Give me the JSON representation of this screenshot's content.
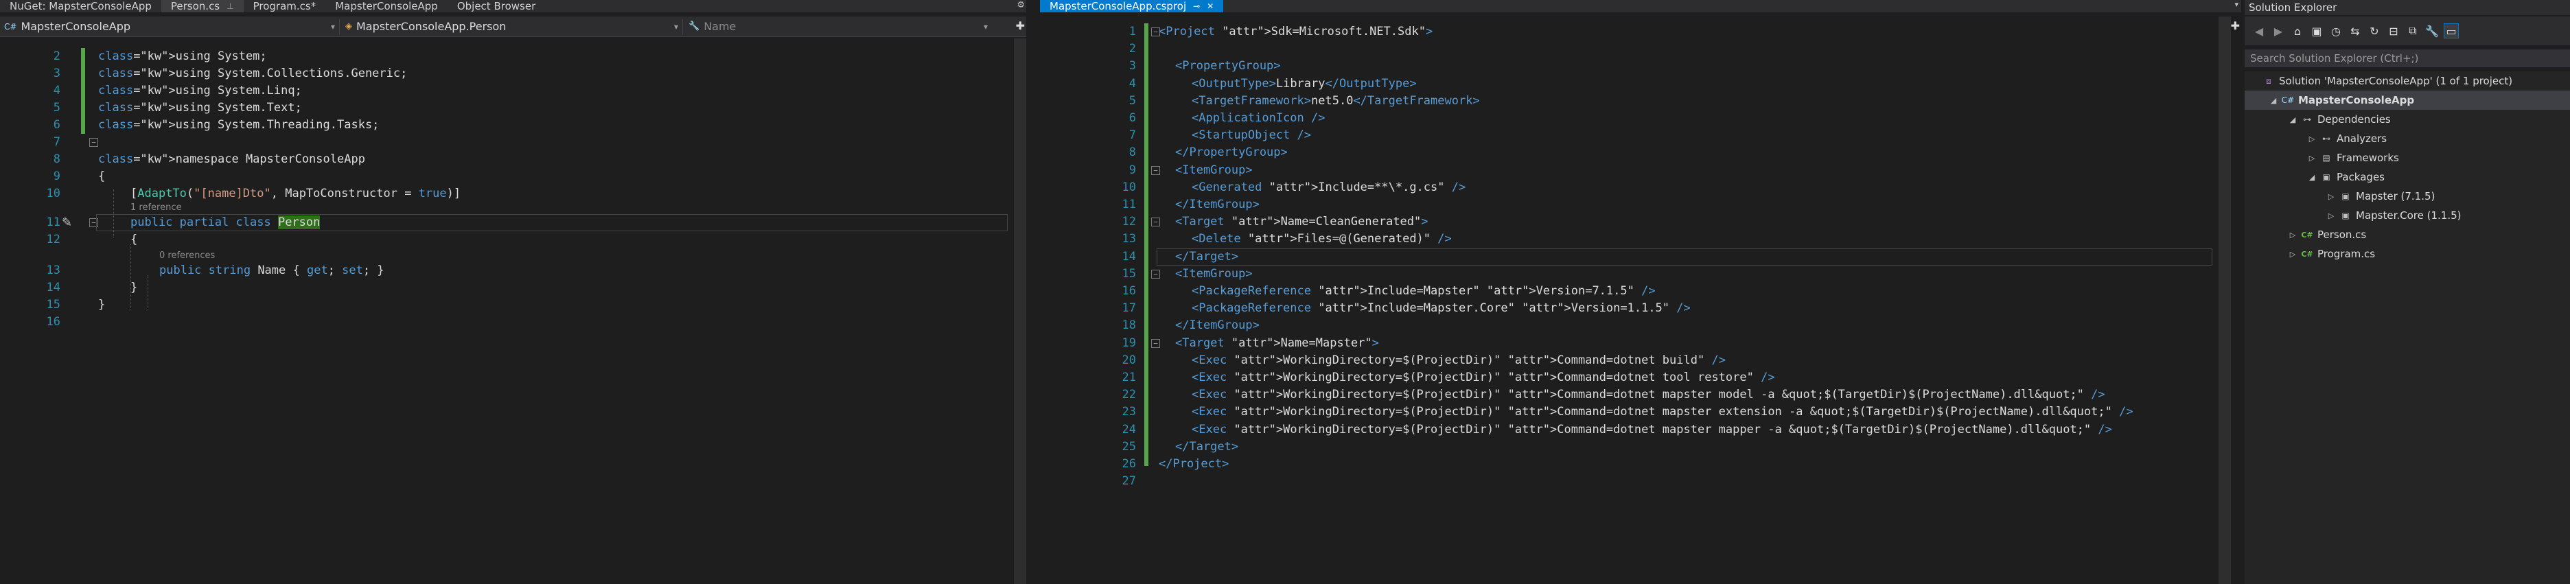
{
  "left_tabs": [
    {
      "label": "NuGet: MapsterConsoleApp",
      "active": false
    },
    {
      "label": "Person.cs",
      "active": false,
      "mark": "⊥"
    },
    {
      "label": "Program.cs*",
      "active": false
    },
    {
      "label": "MapsterConsoleApp",
      "active": false
    },
    {
      "label": "Object Browser",
      "active": false
    }
  ],
  "right_tab": {
    "label": "MapsterConsoleApp.csproj",
    "mark": "⊸",
    "close": "✕"
  },
  "nav": {
    "project": "MapsterConsoleApp",
    "type": "MapsterConsoleApp.Person",
    "member": "Name"
  },
  "cs_editor": {
    "lines": [
      {
        "n": "2",
        "text": "using System;"
      },
      {
        "n": "3",
        "text": "using System.Collections.Generic;"
      },
      {
        "n": "4",
        "text": "using System.Linq;"
      },
      {
        "n": "5",
        "text": "using System.Text;"
      },
      {
        "n": "6",
        "text": "using System.Threading.Tasks;"
      },
      {
        "n": "7",
        "text": ""
      },
      {
        "n": "8",
        "text": "namespace MapsterConsoleApp"
      },
      {
        "n": "9",
        "text": "{"
      },
      {
        "n": "10",
        "text": "[AdaptTo(\"[name]Dto\", MapToConstructor = true)]"
      },
      {
        "n": "11",
        "text": "public partial class Person"
      },
      {
        "n": "12",
        "text": "{"
      },
      {
        "n": "13",
        "text": "public string Name { get; set; }"
      },
      {
        "n": "14",
        "text": "}"
      },
      {
        "n": "15",
        "text": "}"
      },
      {
        "n": "16",
        "text": ""
      }
    ],
    "lens_1": "1 reference",
    "lens_2": "0 references",
    "highlight": "Person"
  },
  "csproj_editor": {
    "lines": [
      {
        "n": "1",
        "text": "<Project Sdk=\"Microsoft.NET.Sdk\">"
      },
      {
        "n": "2",
        "text": ""
      },
      {
        "n": "3",
        "text": "<PropertyGroup>"
      },
      {
        "n": "4",
        "text": "<OutputType>Library</OutputType>"
      },
      {
        "n": "5",
        "text": "<TargetFramework>net5.0</TargetFramework>"
      },
      {
        "n": "6",
        "text": "<ApplicationIcon />"
      },
      {
        "n": "7",
        "text": "<StartupObject />"
      },
      {
        "n": "8",
        "text": "</PropertyGroup>"
      },
      {
        "n": "9",
        "text": "<ItemGroup>"
      },
      {
        "n": "10",
        "text": "<Generated Include=\"**\\*.g.cs\" />"
      },
      {
        "n": "11",
        "text": "</ItemGroup>"
      },
      {
        "n": "12",
        "text": "<Target Name=\"CleanGenerated\">"
      },
      {
        "n": "13",
        "text": "<Delete Files=\"@(Generated)\" />"
      },
      {
        "n": "14",
        "text": "</Target>"
      },
      {
        "n": "15",
        "text": "<ItemGroup>"
      },
      {
        "n": "16",
        "text": "<PackageReference Include=\"Mapster\" Version=\"7.1.5\" />"
      },
      {
        "n": "17",
        "text": "<PackageReference Include=\"Mapster.Core\" Version=\"1.1.5\" />"
      },
      {
        "n": "18",
        "text": "</ItemGroup>"
      },
      {
        "n": "19",
        "text": "<Target Name=\"Mapster\">"
      },
      {
        "n": "20",
        "text": "<Exec WorkingDirectory=\"$(ProjectDir)\" Command=\"dotnet build\" />"
      },
      {
        "n": "21",
        "text": "<Exec WorkingDirectory=\"$(ProjectDir)\" Command=\"dotnet tool restore\" />"
      },
      {
        "n": "22",
        "text": "<Exec WorkingDirectory=\"$(ProjectDir)\" Command=\"dotnet mapster model -a &quot;$(TargetDir)$(ProjectName).dll&quot;\" />"
      },
      {
        "n": "23",
        "text": "<Exec WorkingDirectory=\"$(ProjectDir)\" Command=\"dotnet mapster extension -a &quot;$(TargetDir)$(ProjectName).dll&quot;\" />"
      },
      {
        "n": "24",
        "text": "<Exec WorkingDirectory=\"$(ProjectDir)\" Command=\"dotnet mapster mapper -a &quot;$(TargetDir)$(ProjectName).dll&quot;\" />"
      },
      {
        "n": "25",
        "text": "</Target>"
      },
      {
        "n": "26",
        "text": "</Project>"
      },
      {
        "n": "27",
        "text": ""
      }
    ]
  },
  "solution_explorer": {
    "title": "Solution Explorer",
    "search_placeholder": "Search Solution Explorer (Ctrl+;)",
    "tree": [
      {
        "label": "Solution 'MapsterConsoleApp' (1 of 1 project)",
        "icon": "solution-icon"
      },
      {
        "label": "MapsterConsoleApp",
        "icon": "csharp-project-icon",
        "selected": true
      },
      {
        "label": "Dependencies",
        "icon": "dependencies-icon"
      },
      {
        "label": "Analyzers",
        "icon": "analyzers-icon"
      },
      {
        "label": "Frameworks",
        "icon": "frameworks-icon"
      },
      {
        "label": "Packages",
        "icon": "packages-icon"
      },
      {
        "label": "Mapster (7.1.5)",
        "icon": "package-icon"
      },
      {
        "label": "Mapster.Core (1.1.5)",
        "icon": "package-icon"
      },
      {
        "label": "Person.cs",
        "icon": "csharp-file-icon"
      },
      {
        "label": "Program.cs",
        "icon": "csharp-file-icon"
      }
    ]
  },
  "colors": {
    "accent": "#007acc",
    "keyword": "#569cd6",
    "type": "#4ec9b0",
    "string": "#d69d85",
    "line_number": "#2b91af",
    "change_bar": "#57a64a"
  }
}
